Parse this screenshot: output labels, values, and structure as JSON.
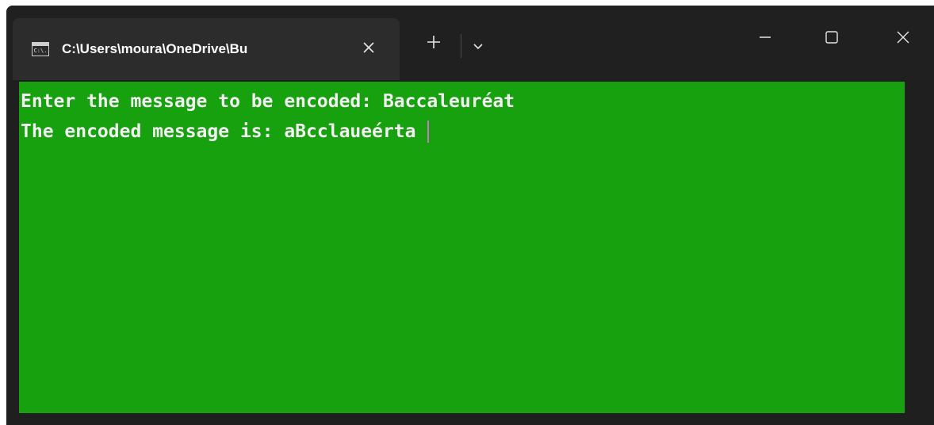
{
  "window": {
    "tab_title": "C:\\Users\\moura\\OneDrive\\Bu",
    "tab_icon_text": "C:\\."
  },
  "terminal": {
    "background_color": "#17a10f",
    "text_color": "#f2f2f2",
    "cursor_color": "#c37ac4",
    "lines": [
      "Enter the message to be encoded: Baccaleuréat",
      "The encoded message is: aBcclaueérta"
    ]
  },
  "icons": {
    "tab_icon": "console-icon",
    "tab_close": "close-icon",
    "new_tab": "plus-icon",
    "dropdown": "chevron-down-icon",
    "minimize": "minimize-icon",
    "maximize": "maximize-icon",
    "close": "close-icon"
  }
}
